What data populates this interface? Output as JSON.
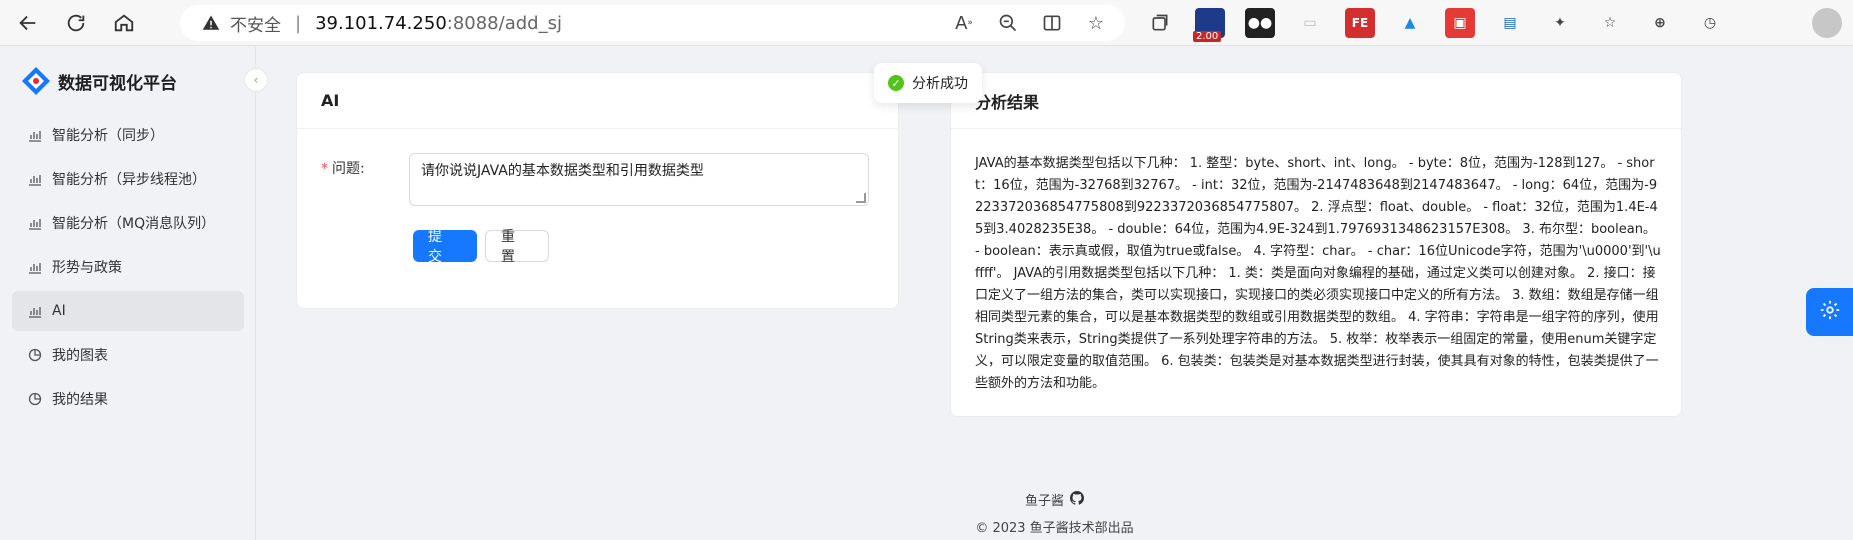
{
  "browser": {
    "insecure_label": "不安全",
    "url_host": "39.101.74.250",
    "url_rest": ":8088/add_sj",
    "extension_badge": "2.00"
  },
  "sidebar": {
    "title": "数据可视化平台",
    "items": [
      {
        "label": "智能分析（同步）",
        "icon": "bar-chart-icon"
      },
      {
        "label": "智能分析（异步线程池）",
        "icon": "bar-chart-icon"
      },
      {
        "label": "智能分析（MQ消息队列）",
        "icon": "bar-chart-icon"
      },
      {
        "label": "形势与政策",
        "icon": "bar-chart-icon"
      },
      {
        "label": "AI",
        "icon": "bar-chart-icon",
        "active": true
      },
      {
        "label": "我的图表",
        "icon": "pie-chart-icon"
      },
      {
        "label": "我的结果",
        "icon": "pie-chart-icon"
      }
    ]
  },
  "form_card": {
    "title": "AI",
    "question_label": "问题:",
    "question_value": "请你说说JAVA的基本数据类型和引用数据类型",
    "submit_label": "提交",
    "reset_label": "重置"
  },
  "result_card": {
    "title": "分析结果",
    "text": "JAVA的基本数据类型包括以下几种： 1. 整型：byte、short、int、long。 - byte：8位，范围为-128到127。 - short：16位，范围为-32768到32767。 - int：32位，范围为-2147483648到2147483647。 - long：64位，范围为-9223372036854775808到9223372036854775807。 2. 浮点型：float、double。 - float：32位，范围为1.4E-45到3.4028235E38。 - double：64位，范围为4.9E-324到1.7976931348623157E308。 3. 布尔型：boolean。 - boolean：表示真或假，取值为true或false。 4. 字符型：char。 - char：16位Unicode字符，范围为'\\u0000'到'\\uffff'。 JAVA的引用数据类型包括以下几种： 1. 类：类是面向对象编程的基础，通过定义类可以创建对象。 2. 接口：接口定义了一组方法的集合，类可以实现接口，实现接口的类必须实现接口中定义的所有方法。 3. 数组：数组是存储一组相同类型元素的集合，可以是基本数据类型的数组或引用数据类型的数组。 4. 字符串：字符串是一组字符的序列，使用String类来表示，String类提供了一系列处理字符串的方法。 5. 枚举：枚举表示一组固定的常量，使用enum关键字定义，可以限定变量的取值范围。 6. 包装类：包装类是对基本数据类型进行封装，使其具有对象的特性，包装类提供了一些额外的方法和功能。"
  },
  "toast": {
    "message": "分析成功"
  },
  "footer": {
    "author": "鱼子酱",
    "copyright": "© 2023 鱼子酱技术部出品"
  },
  "colors": {
    "primary": "#1677ff",
    "success": "#52c41a",
    "required": "#ff4d4f"
  }
}
